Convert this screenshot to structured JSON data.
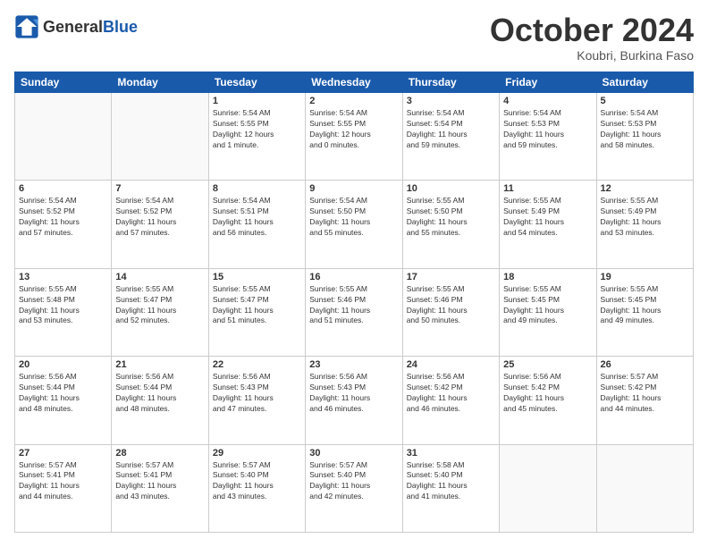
{
  "header": {
    "logo_general": "General",
    "logo_blue": "Blue",
    "month_title": "October 2024",
    "subtitle": "Koubri, Burkina Faso"
  },
  "days_of_week": [
    "Sunday",
    "Monday",
    "Tuesday",
    "Wednesday",
    "Thursday",
    "Friday",
    "Saturday"
  ],
  "weeks": [
    [
      {
        "day": "",
        "info": ""
      },
      {
        "day": "",
        "info": ""
      },
      {
        "day": "1",
        "info": "Sunrise: 5:54 AM\nSunset: 5:55 PM\nDaylight: 12 hours\nand 1 minute."
      },
      {
        "day": "2",
        "info": "Sunrise: 5:54 AM\nSunset: 5:55 PM\nDaylight: 12 hours\nand 0 minutes."
      },
      {
        "day": "3",
        "info": "Sunrise: 5:54 AM\nSunset: 5:54 PM\nDaylight: 11 hours\nand 59 minutes."
      },
      {
        "day": "4",
        "info": "Sunrise: 5:54 AM\nSunset: 5:53 PM\nDaylight: 11 hours\nand 59 minutes."
      },
      {
        "day": "5",
        "info": "Sunrise: 5:54 AM\nSunset: 5:53 PM\nDaylight: 11 hours\nand 58 minutes."
      }
    ],
    [
      {
        "day": "6",
        "info": "Sunrise: 5:54 AM\nSunset: 5:52 PM\nDaylight: 11 hours\nand 57 minutes."
      },
      {
        "day": "7",
        "info": "Sunrise: 5:54 AM\nSunset: 5:52 PM\nDaylight: 11 hours\nand 57 minutes."
      },
      {
        "day": "8",
        "info": "Sunrise: 5:54 AM\nSunset: 5:51 PM\nDaylight: 11 hours\nand 56 minutes."
      },
      {
        "day": "9",
        "info": "Sunrise: 5:54 AM\nSunset: 5:50 PM\nDaylight: 11 hours\nand 55 minutes."
      },
      {
        "day": "10",
        "info": "Sunrise: 5:55 AM\nSunset: 5:50 PM\nDaylight: 11 hours\nand 55 minutes."
      },
      {
        "day": "11",
        "info": "Sunrise: 5:55 AM\nSunset: 5:49 PM\nDaylight: 11 hours\nand 54 minutes."
      },
      {
        "day": "12",
        "info": "Sunrise: 5:55 AM\nSunset: 5:49 PM\nDaylight: 11 hours\nand 53 minutes."
      }
    ],
    [
      {
        "day": "13",
        "info": "Sunrise: 5:55 AM\nSunset: 5:48 PM\nDaylight: 11 hours\nand 53 minutes."
      },
      {
        "day": "14",
        "info": "Sunrise: 5:55 AM\nSunset: 5:47 PM\nDaylight: 11 hours\nand 52 minutes."
      },
      {
        "day": "15",
        "info": "Sunrise: 5:55 AM\nSunset: 5:47 PM\nDaylight: 11 hours\nand 51 minutes."
      },
      {
        "day": "16",
        "info": "Sunrise: 5:55 AM\nSunset: 5:46 PM\nDaylight: 11 hours\nand 51 minutes."
      },
      {
        "day": "17",
        "info": "Sunrise: 5:55 AM\nSunset: 5:46 PM\nDaylight: 11 hours\nand 50 minutes."
      },
      {
        "day": "18",
        "info": "Sunrise: 5:55 AM\nSunset: 5:45 PM\nDaylight: 11 hours\nand 49 minutes."
      },
      {
        "day": "19",
        "info": "Sunrise: 5:55 AM\nSunset: 5:45 PM\nDaylight: 11 hours\nand 49 minutes."
      }
    ],
    [
      {
        "day": "20",
        "info": "Sunrise: 5:56 AM\nSunset: 5:44 PM\nDaylight: 11 hours\nand 48 minutes."
      },
      {
        "day": "21",
        "info": "Sunrise: 5:56 AM\nSunset: 5:44 PM\nDaylight: 11 hours\nand 48 minutes."
      },
      {
        "day": "22",
        "info": "Sunrise: 5:56 AM\nSunset: 5:43 PM\nDaylight: 11 hours\nand 47 minutes."
      },
      {
        "day": "23",
        "info": "Sunrise: 5:56 AM\nSunset: 5:43 PM\nDaylight: 11 hours\nand 46 minutes."
      },
      {
        "day": "24",
        "info": "Sunrise: 5:56 AM\nSunset: 5:42 PM\nDaylight: 11 hours\nand 46 minutes."
      },
      {
        "day": "25",
        "info": "Sunrise: 5:56 AM\nSunset: 5:42 PM\nDaylight: 11 hours\nand 45 minutes."
      },
      {
        "day": "26",
        "info": "Sunrise: 5:57 AM\nSunset: 5:42 PM\nDaylight: 11 hours\nand 44 minutes."
      }
    ],
    [
      {
        "day": "27",
        "info": "Sunrise: 5:57 AM\nSunset: 5:41 PM\nDaylight: 11 hours\nand 44 minutes."
      },
      {
        "day": "28",
        "info": "Sunrise: 5:57 AM\nSunset: 5:41 PM\nDaylight: 11 hours\nand 43 minutes."
      },
      {
        "day": "29",
        "info": "Sunrise: 5:57 AM\nSunset: 5:40 PM\nDaylight: 11 hours\nand 43 minutes."
      },
      {
        "day": "30",
        "info": "Sunrise: 5:57 AM\nSunset: 5:40 PM\nDaylight: 11 hours\nand 42 minutes."
      },
      {
        "day": "31",
        "info": "Sunrise: 5:58 AM\nSunset: 5:40 PM\nDaylight: 11 hours\nand 41 minutes."
      },
      {
        "day": "",
        "info": ""
      },
      {
        "day": "",
        "info": ""
      }
    ]
  ]
}
